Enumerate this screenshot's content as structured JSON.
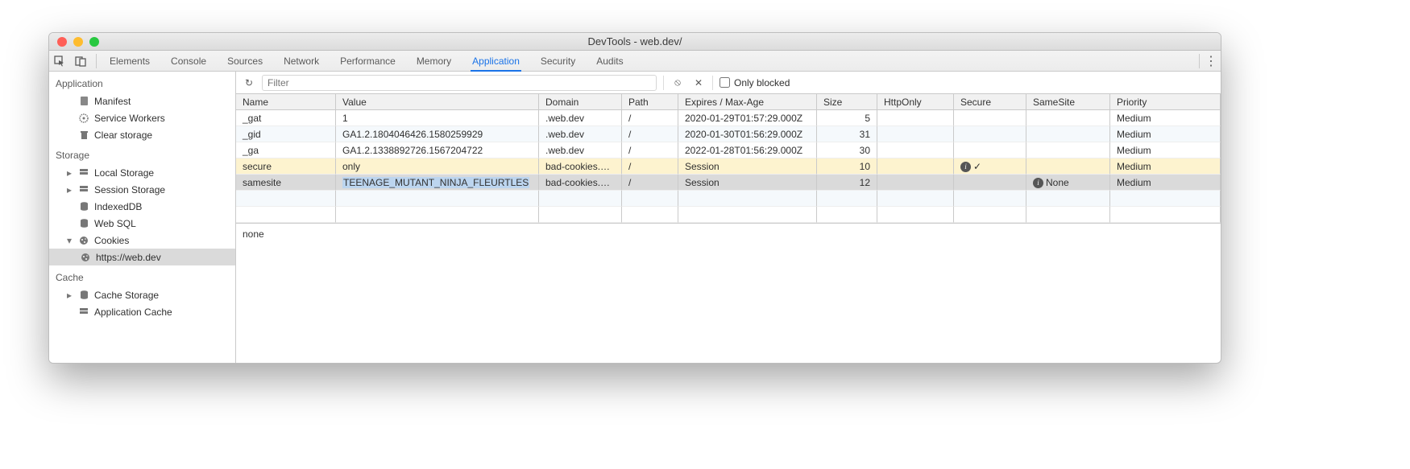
{
  "window_title": "DevTools - web.dev/",
  "tabs": {
    "items": [
      "Elements",
      "Console",
      "Sources",
      "Network",
      "Performance",
      "Memory",
      "Application",
      "Security",
      "Audits"
    ],
    "active": "Application"
  },
  "sidebar": {
    "heading_application": "Application",
    "manifest": "Manifest",
    "service_workers": "Service Workers",
    "clear_storage": "Clear storage",
    "heading_storage": "Storage",
    "local_storage": "Local Storage",
    "session_storage": "Session Storage",
    "indexeddb": "IndexedDB",
    "websql": "Web SQL",
    "cookies": "Cookies",
    "cookies_child": "https://web.dev",
    "heading_cache": "Cache",
    "cache_storage": "Cache Storage",
    "application_cache": "Application Cache"
  },
  "toolbar": {
    "filter_placeholder": "Filter",
    "only_blocked": "Only blocked"
  },
  "columns": {
    "name": "Name",
    "value": "Value",
    "domain": "Domain",
    "path": "Path",
    "expires": "Expires / Max-Age",
    "size": "Size",
    "httponly": "HttpOnly",
    "secure": "Secure",
    "samesite": "SameSite",
    "priority": "Priority"
  },
  "rows": [
    {
      "name": "_gat",
      "value": "1",
      "domain": ".web.dev",
      "path": "/",
      "expires": "2020-01-29T01:57:29.000Z",
      "size": "5",
      "httponly": "",
      "secure": "",
      "samesite": "",
      "priority": "Medium",
      "style": "plain"
    },
    {
      "name": "_gid",
      "value": "GA1.2.1804046426.1580259929",
      "domain": ".web.dev",
      "path": "/",
      "expires": "2020-01-30T01:56:29.000Z",
      "size": "31",
      "httponly": "",
      "secure": "",
      "samesite": "",
      "priority": "Medium",
      "style": "alt"
    },
    {
      "name": "_ga",
      "value": "GA1.2.1338892726.1567204722",
      "domain": ".web.dev",
      "path": "/",
      "expires": "2022-01-28T01:56:29.000Z",
      "size": "30",
      "httponly": "",
      "secure": "",
      "samesite": "",
      "priority": "Medium",
      "style": "plain"
    },
    {
      "name": "secure",
      "value": "only",
      "domain": "bad-cookies.g…",
      "path": "/",
      "expires": "Session",
      "size": "10",
      "httponly": "",
      "secure": "info-check",
      "samesite": "",
      "priority": "Medium",
      "style": "warn"
    },
    {
      "name": "samesite",
      "value": "TEENAGE_MUTANT_NINJA_FLEURTLES",
      "domain": "bad-cookies.g…",
      "path": "/",
      "expires": "Session",
      "size": "12",
      "httponly": "",
      "secure": "",
      "samesite": "info-none",
      "samesite_text": "None",
      "priority": "Medium",
      "style": "sel",
      "value_hl": true
    }
  ],
  "detail_value": "none"
}
